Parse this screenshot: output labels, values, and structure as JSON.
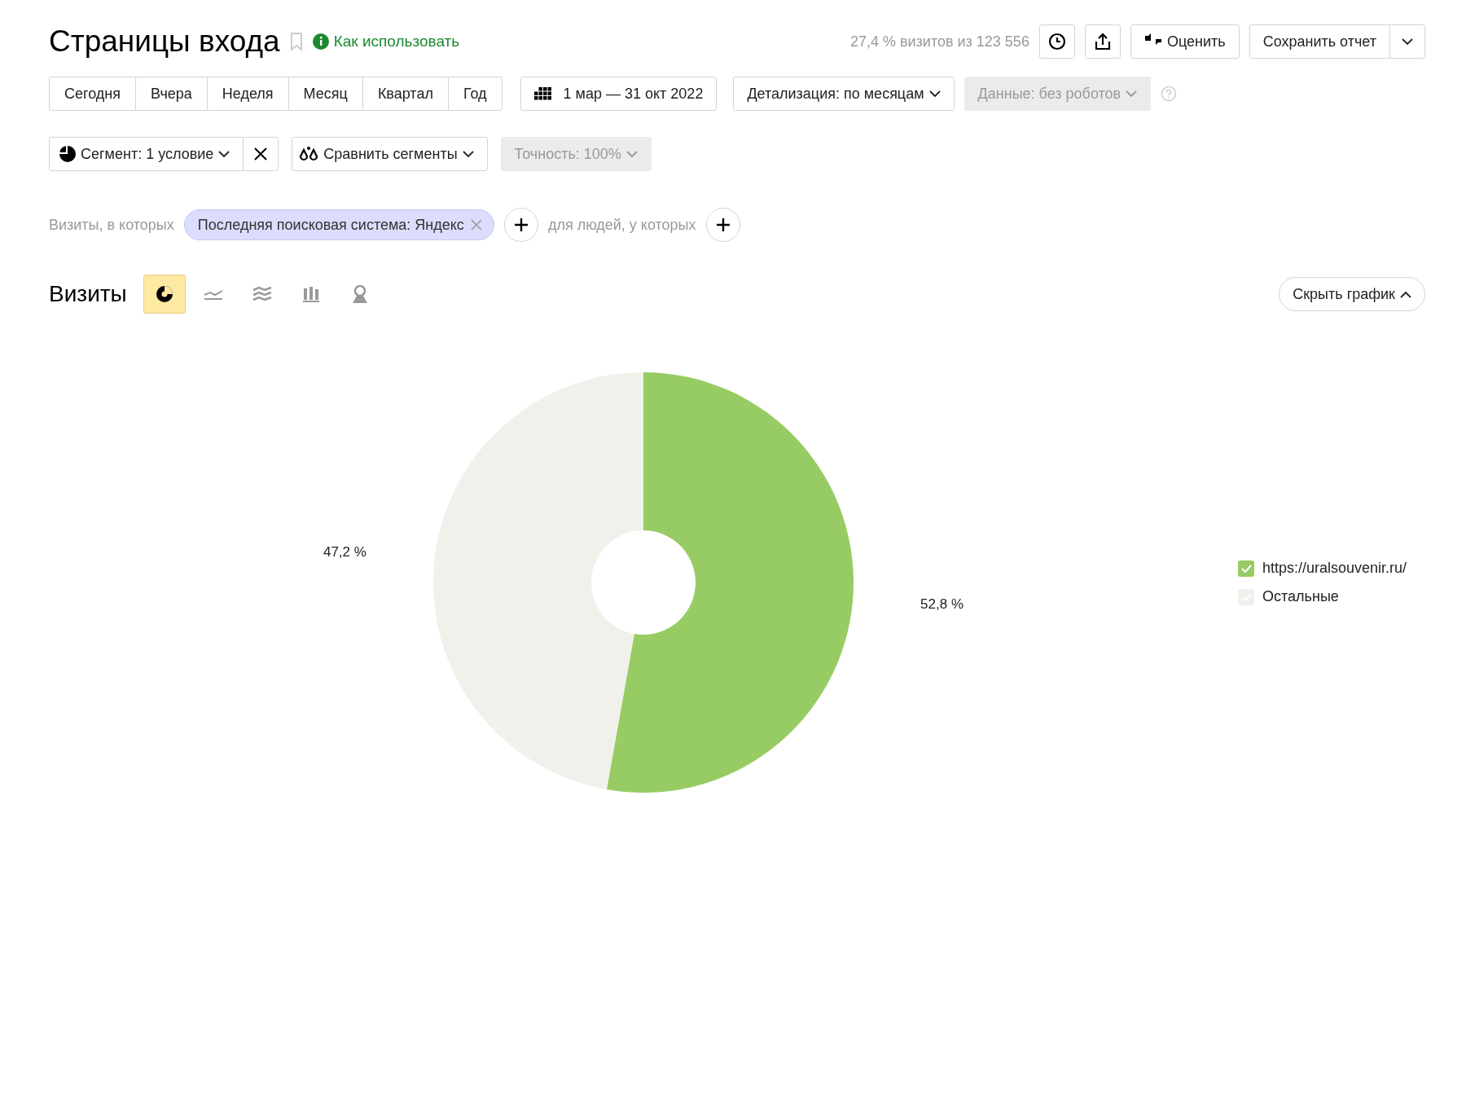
{
  "header": {
    "title": "Страницы входа",
    "help_link": "Как использовать",
    "visits_share": "27,4 % визитов из 123 556",
    "rate_button": "Оценить",
    "save_button": "Сохранить отчет"
  },
  "periods": [
    {
      "label": "Сегодня",
      "selected": false
    },
    {
      "label": "Вчера",
      "selected": false
    },
    {
      "label": "Неделя",
      "selected": false
    },
    {
      "label": "Месяц",
      "selected": false
    },
    {
      "label": "Квартал",
      "selected": false
    },
    {
      "label": "Год",
      "selected": false
    }
  ],
  "date_range": "1 мар — 31 окт 2022",
  "detail": {
    "label": "Детализация: по месяцам",
    "disabled": false
  },
  "data_filter": {
    "label": "Данные: без роботов",
    "disabled": true
  },
  "segment": {
    "label": "Сегмент: 1 условие",
    "compare": "Сравнить сегменты",
    "accuracy": "Точность: 100%",
    "accuracy_disabled": true
  },
  "conditions": {
    "visits_prefix": "Визиты, в которых",
    "tag": "Последняя поисковая система: Яндекс",
    "people_prefix": "для людей, у которых"
  },
  "chart_section": {
    "title": "Визиты",
    "hide_button": "Скрыть график",
    "chart_types": [
      {
        "kind": "pie",
        "selected": true
      },
      {
        "kind": "line",
        "selected": false
      },
      {
        "kind": "area",
        "selected": false
      },
      {
        "kind": "bar",
        "selected": false
      },
      {
        "kind": "map",
        "selected": false
      }
    ],
    "chart_data": {
      "type": "donut",
      "categories": [
        "https://uralsouvenir.ru/",
        "Остальные"
      ],
      "values": [
        52.8,
        47.2
      ],
      "value_labels": [
        "52,8 %",
        "47,2 %"
      ]
    },
    "legend": [
      {
        "color": "#97cc64",
        "checked": true
      },
      {
        "color": "#f2f0eb",
        "checked": true
      }
    ]
  }
}
